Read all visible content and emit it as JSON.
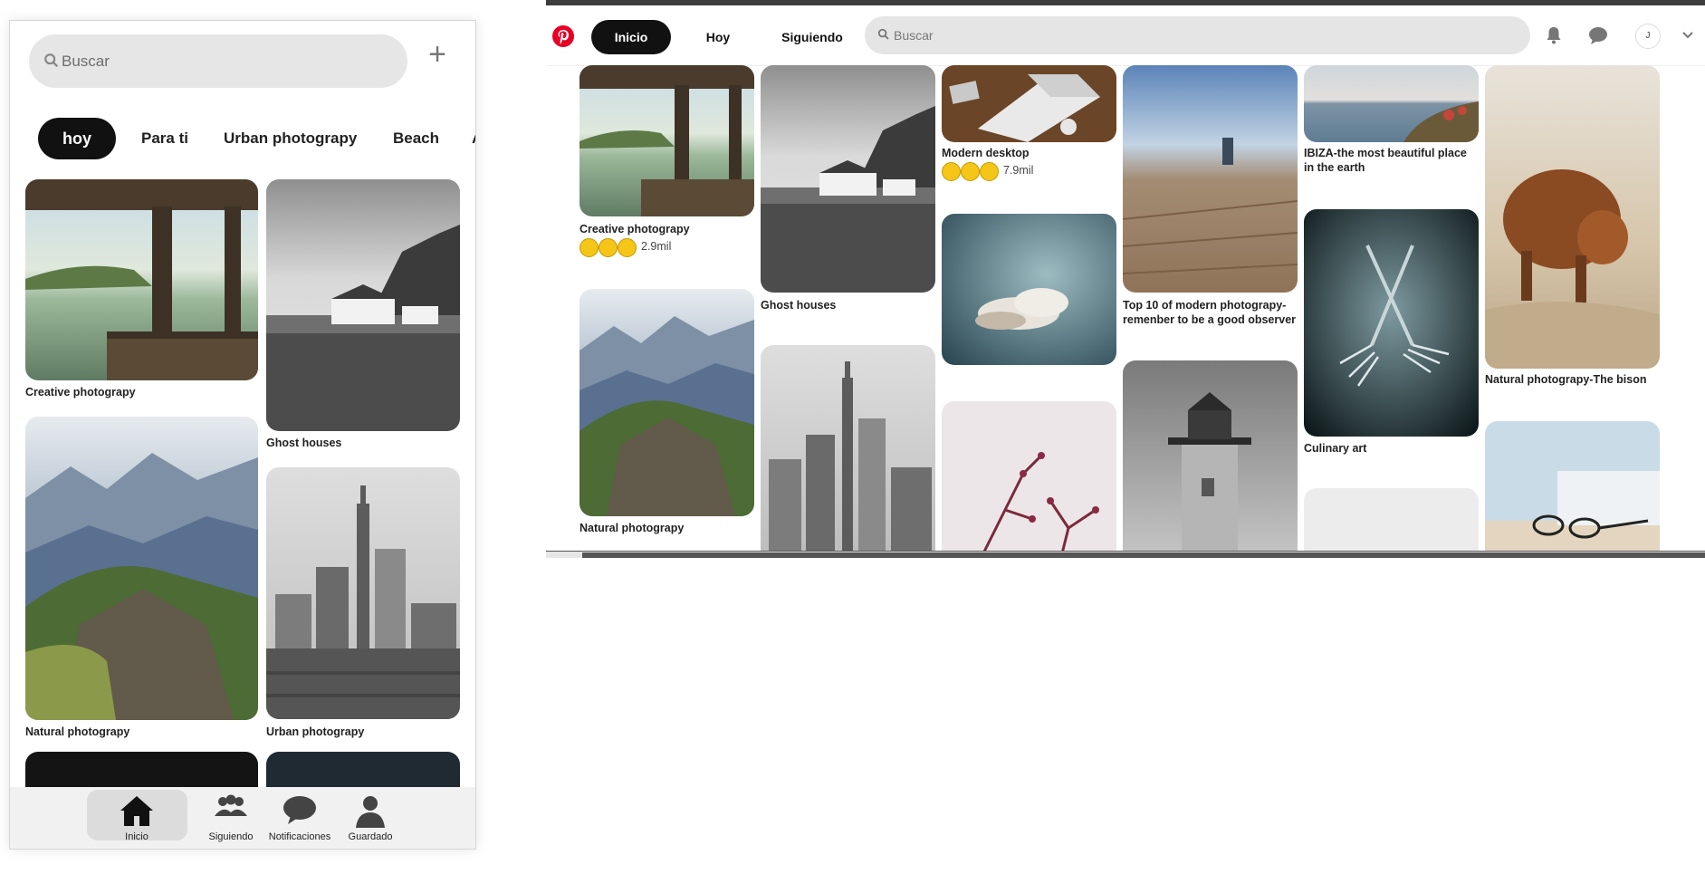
{
  "mobile": {
    "search": {
      "placeholder": "Buscar"
    },
    "add_button": "+",
    "tabs": [
      {
        "label": "hoy",
        "active": true
      },
      {
        "label": "Para ti"
      },
      {
        "label": "Urban photograpy"
      },
      {
        "label": "Beach"
      },
      {
        "label": "Ar"
      }
    ],
    "pins": [
      {
        "caption": "Creative photograpy"
      },
      {
        "caption": "Ghost houses"
      },
      {
        "caption": "Natural photograpy"
      },
      {
        "caption": "Urban photograpy"
      }
    ],
    "nav": [
      {
        "label": "Inicio",
        "icon": "home-icon",
        "active": true
      },
      {
        "label": "Siguiendo",
        "icon": "people-icon"
      },
      {
        "label": "Notificaciones",
        "icon": "chat-icon"
      },
      {
        "label": "Guardado",
        "icon": "user-icon"
      }
    ]
  },
  "desktop": {
    "logo": "pinterest-logo",
    "nav": {
      "inicio": "Inicio",
      "hoy": "Hoy",
      "siguiendo": "Siguiendo"
    },
    "search": {
      "placeholder": "Buscar"
    },
    "avatar_initial": "J",
    "pins": [
      {
        "caption": "Creative photograpy",
        "reaction_count": "2.9mil"
      },
      {
        "caption": "Natural photograpy"
      },
      {
        "caption": "Ghost houses"
      },
      {
        "caption": "Modern desktop",
        "reaction_count": "7.9mil"
      },
      {
        "caption": "Top 10 of modern photograpy-remenber to be a good observer"
      },
      {
        "caption": "IBIZA-the most beautiful place in the earth"
      },
      {
        "caption": "Culinary art"
      },
      {
        "caption": "Natural photograpy-The bison"
      }
    ]
  },
  "colors": {
    "brand": "#e60023",
    "active_pill": "#111111",
    "search_bg": "#e6e6e6"
  }
}
